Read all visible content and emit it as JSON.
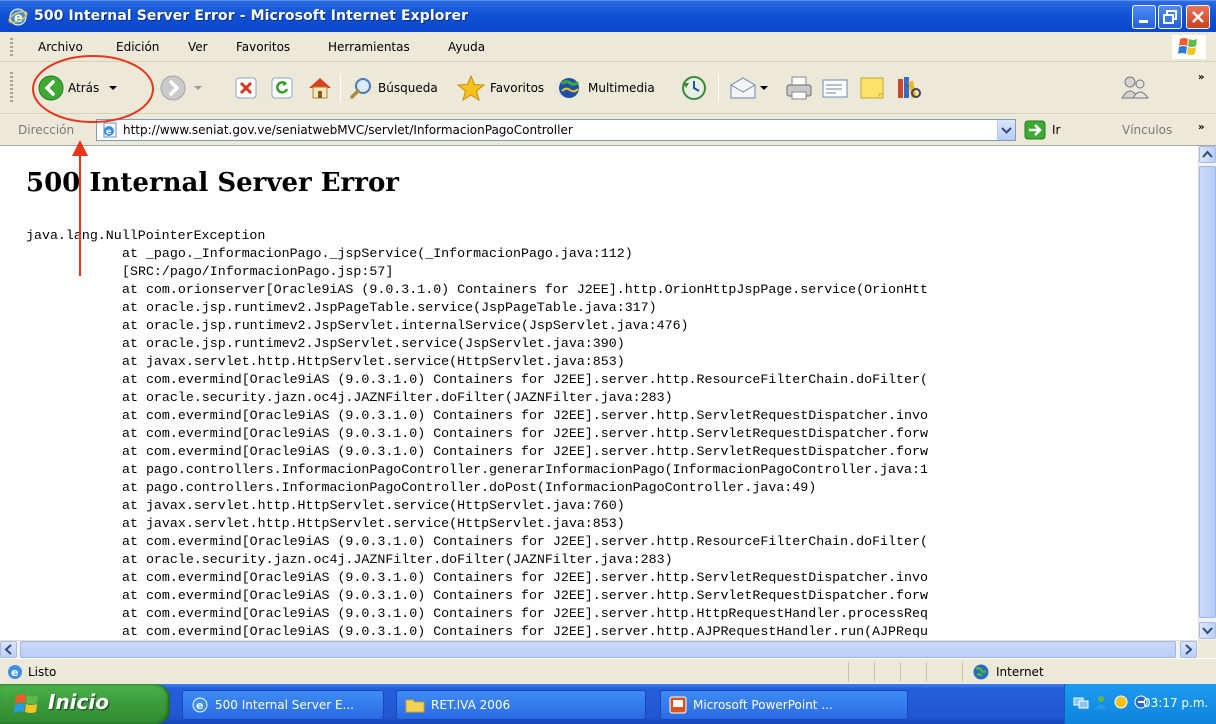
{
  "window": {
    "title": "500 Internal Server Error - Microsoft Internet Explorer"
  },
  "menu": [
    "Archivo",
    "Edición",
    "Ver",
    "Favoritos",
    "Herramientas",
    "Ayuda"
  ],
  "toolbar": {
    "back": "Atrás",
    "search": "Búsqueda",
    "favorites": "Favoritos",
    "multimedia": "Multimedia"
  },
  "address": {
    "label": "Dirección",
    "url": "http://www.seniat.gov.ve/seniatwebMVC/servlet/InformacionPagoController",
    "go": "Ir",
    "links": "Vínculos"
  },
  "page": {
    "heading": "500 Internal Server Error",
    "exception": "java.lang.NullPointerException",
    "stack": [
      "at _pago._InformacionPago._jspService(_InformacionPago.java:112)",
      "[SRC:/pago/InformacionPago.jsp:57]",
      "at com.orionserver[Oracle9iAS (9.0.3.1.0) Containers for J2EE].http.OrionHttpJspPage.service(OrionHtt",
      "at oracle.jsp.runtimev2.JspPageTable.service(JspPageTable.java:317)",
      "at oracle.jsp.runtimev2.JspServlet.internalService(JspServlet.java:476)",
      "at oracle.jsp.runtimev2.JspServlet.service(JspServlet.java:390)",
      "at javax.servlet.http.HttpServlet.service(HttpServlet.java:853)",
      "at com.evermind[Oracle9iAS (9.0.3.1.0) Containers for J2EE].server.http.ResourceFilterChain.doFilter(",
      "at oracle.security.jazn.oc4j.JAZNFilter.doFilter(JAZNFilter.java:283)",
      "at com.evermind[Oracle9iAS (9.0.3.1.0) Containers for J2EE].server.http.ServletRequestDispatcher.invo",
      "at com.evermind[Oracle9iAS (9.0.3.1.0) Containers for J2EE].server.http.ServletRequestDispatcher.forw",
      "at com.evermind[Oracle9iAS (9.0.3.1.0) Containers for J2EE].server.http.ServletRequestDispatcher.forw",
      "at pago.controllers.InformacionPagoController.generarInformacionPago(InformacionPagoController.java:1",
      "at pago.controllers.InformacionPagoController.doPost(InformacionPagoController.java:49)",
      "at javax.servlet.http.HttpServlet.service(HttpServlet.java:760)",
      "at javax.servlet.http.HttpServlet.service(HttpServlet.java:853)",
      "at com.evermind[Oracle9iAS (9.0.3.1.0) Containers for J2EE].server.http.ResourceFilterChain.doFilter(",
      "at oracle.security.jazn.oc4j.JAZNFilter.doFilter(JAZNFilter.java:283)",
      "at com.evermind[Oracle9iAS (9.0.3.1.0) Containers for J2EE].server.http.ServletRequestDispatcher.invo",
      "at com.evermind[Oracle9iAS (9.0.3.1.0) Containers for J2EE].server.http.ServletRequestDispatcher.forw",
      "at com.evermind[Oracle9iAS (9.0.3.1.0) Containers for J2EE].server.http.HttpRequestHandler.processReq",
      "at com.evermind[Oracle9iAS (9.0.3.1.0) Containers for J2EE].server.http.AJPRequestHandler.run(AJPRequ"
    ]
  },
  "status": {
    "text": "Listo",
    "zone": "Internet"
  },
  "taskbar": {
    "start": "Inicio",
    "tasks": [
      "500 Internal Server E...",
      "RET.IVA 2006",
      "Microsoft PowerPoint ..."
    ],
    "clock": "03:17 p.m."
  },
  "colors": {
    "titlebar": "#0a46c8",
    "chrome": "#ece9d8",
    "annotation": "#e8361c",
    "taskbar": "#245edb",
    "start": "#3c9a3c"
  },
  "icons": [
    "ie-logo-icon",
    "minimize-icon",
    "maximize-icon",
    "close-icon",
    "back-icon",
    "forward-icon",
    "stop-icon",
    "refresh-icon",
    "home-icon",
    "search-icon",
    "favorites-star-icon",
    "multimedia-icon",
    "history-icon",
    "mail-icon",
    "print-icon",
    "edit-icon",
    "notes-icon",
    "research-icon",
    "messenger-icon",
    "go-arrow-icon",
    "internet-zone-icon"
  ]
}
